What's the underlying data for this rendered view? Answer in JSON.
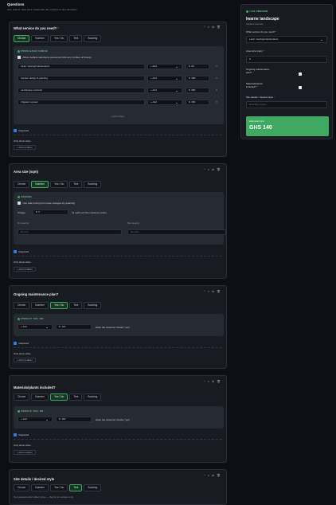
{
  "header": {
    "title": "Questions",
    "subtitle": "Ask, branch, then price. Read with the customer's first decisions."
  },
  "tabs": [
    "Choice",
    "Number",
    "Yes / No",
    "Text",
    "Booking"
  ],
  "tools": "^ v ⧉ 🗑",
  "required_label": "Required",
  "only_show_label": "Only show when",
  "add_condition": "+ Add condition",
  "q1": {
    "title": "What service do you need?",
    "active_tab": 0,
    "pricing_label": "PRICE EACH CHOICE",
    "multi_label": "Allow multiple selections (customer ticks any number of boxes)",
    "options": [
      {
        "name": "Lawn mowing/maintenance",
        "mode": "+ Add",
        "amount": "60"
      },
      {
        "name": "Garden design & planting",
        "mode": "+ Add",
        "amount": "280"
      },
      {
        "name": "Landscape overhaul",
        "mode": "+ Add",
        "amount": "680"
      },
      {
        "name": "Irrigation system",
        "mode": "+ Add",
        "amount": "350"
      }
    ],
    "add_choice": "+ Add choice"
  },
  "q2": {
    "title": "Area size (sqm)",
    "active_tab": 1,
    "pricing_label": "PRICING",
    "per_qty_label": "Use bulk pricing form (rate changes by quantity)",
    "charge_label": "Charge",
    "charge_amount": "5",
    "charge_suffix": "for each unit the customer enters.",
    "min_label": "Min quantity",
    "min_placeholder": "No min",
    "max_label": "Max quantity",
    "max_placeholder": "No max"
  },
  "q3": {
    "title": "Ongoing maintenance plan?",
    "active_tab": 2,
    "pricing_label": "PRICE IF YES: ON",
    "mode": "+ Add",
    "amount": "120",
    "suffix": "when the customer checks \"yes\"."
  },
  "q4": {
    "title": "Materials/plants included?",
    "active_tab": 2,
    "pricing_label": "PRICE IF YES: ON",
    "mode": "+ Add",
    "amount": "160",
    "suffix": "when the customer checks \"yes\"."
  },
  "q5": {
    "title": "Site details / desired style",
    "active_tab": 3,
    "note": "Text answers don't affect price — they're for context only."
  },
  "currency": "$",
  "preview": {
    "tag": "LIVE PREVIEW",
    "title": "Iwarne landscape",
    "sub": "Sealand estimate",
    "q1_label": "What service do you need?",
    "q1_value": "Lawn mowing/maintenance",
    "q2_label": "Area size (sqm)",
    "q2_value": "0",
    "q3_label": "Ongoing maintenance plan?",
    "q4_label": "Materials/plants included?",
    "q5_label": "Site details / desired style",
    "q5_placeholder": "Describe project",
    "total_label": "Estimated total",
    "total_value": "GHS 140"
  },
  "colors": {
    "accent": "#3fa861",
    "bg": "#0d0f14",
    "card": "#181b22"
  }
}
